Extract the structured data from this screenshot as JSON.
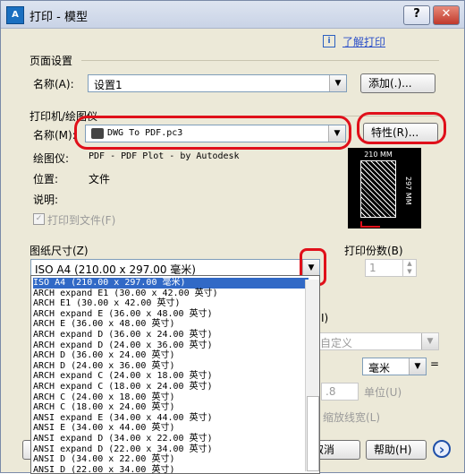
{
  "window": {
    "title": "打印 - 模型",
    "app_icon_text": "A",
    "help_symbol": "?",
    "close_symbol": "✕"
  },
  "help_link": {
    "icon_text": "i",
    "label": "了解打印"
  },
  "page_setup": {
    "section_label": "页面设置",
    "name_label": "名称(A):",
    "name_value": "设置1",
    "add_button": "添加(.)..."
  },
  "printer": {
    "section_label": "打印机/绘图仪",
    "name_label": "名称(M):",
    "name_value": "DWG To PDF.pc3",
    "properties_button": "特性(R)...",
    "plotter_label": "绘图仪:",
    "plotter_value": "PDF - PDF Plot - by Autodesk",
    "location_label": "位置:",
    "location_value": "文件",
    "description_label": "说明:",
    "print_to_file_label": "打印到文件(F)",
    "print_to_file_checked": true
  },
  "preview": {
    "width_label": "210 MM",
    "height_label": "297 MM"
  },
  "paper_size": {
    "section_label": "图纸尺寸(Z)",
    "selected": "ISO A4 (210.00 x 297.00 毫米)",
    "options": [
      "ISO A4 (210.00 x 297.00 毫米)",
      "ARCH expand E1 (30.00 x 42.00 英寸)",
      "ARCH E1 (30.00 x 42.00 英寸)",
      "ARCH expand E (36.00 x 48.00 英寸)",
      "ARCH E (36.00 x 48.00 英寸)",
      "ARCH expand D (36.00 x 24.00 英寸)",
      "ARCH expand D (24.00 x 36.00 英寸)",
      "ARCH D (36.00 x 24.00 英寸)",
      "ARCH D (24.00 x 36.00 英寸)",
      "ARCH expand C (24.00 x 18.00 英寸)",
      "ARCH expand C (18.00 x 24.00 英寸)",
      "ARCH C (24.00 x 18.00 英寸)",
      "ARCH C (18.00 x 24.00 英寸)",
      "ANSI expand E (34.00 x 44.00 英寸)",
      "ANSI E (34.00 x 44.00 英寸)",
      "ANSI expand D (34.00 x 22.00 英寸)",
      "ANSI expand D (22.00 x 34.00 英寸)",
      "ANSI D (34.00 x 22.00 英寸)",
      "ANSI D (22.00 x 34.00 英寸)"
    ]
  },
  "copies": {
    "label": "打印份数(B)",
    "value": "1"
  },
  "scale": {
    "partial_label": "I)",
    "custom_value": "自定义",
    "unit_value": "毫米",
    "equals": "=",
    "units_value": ".8",
    "units_label": "单位(U)",
    "scale_lineweights": "缩放线宽(L)"
  },
  "footer": {
    "cancel_partial": "取消",
    "help_button": "帮助(H)",
    "more_symbol": "›"
  }
}
